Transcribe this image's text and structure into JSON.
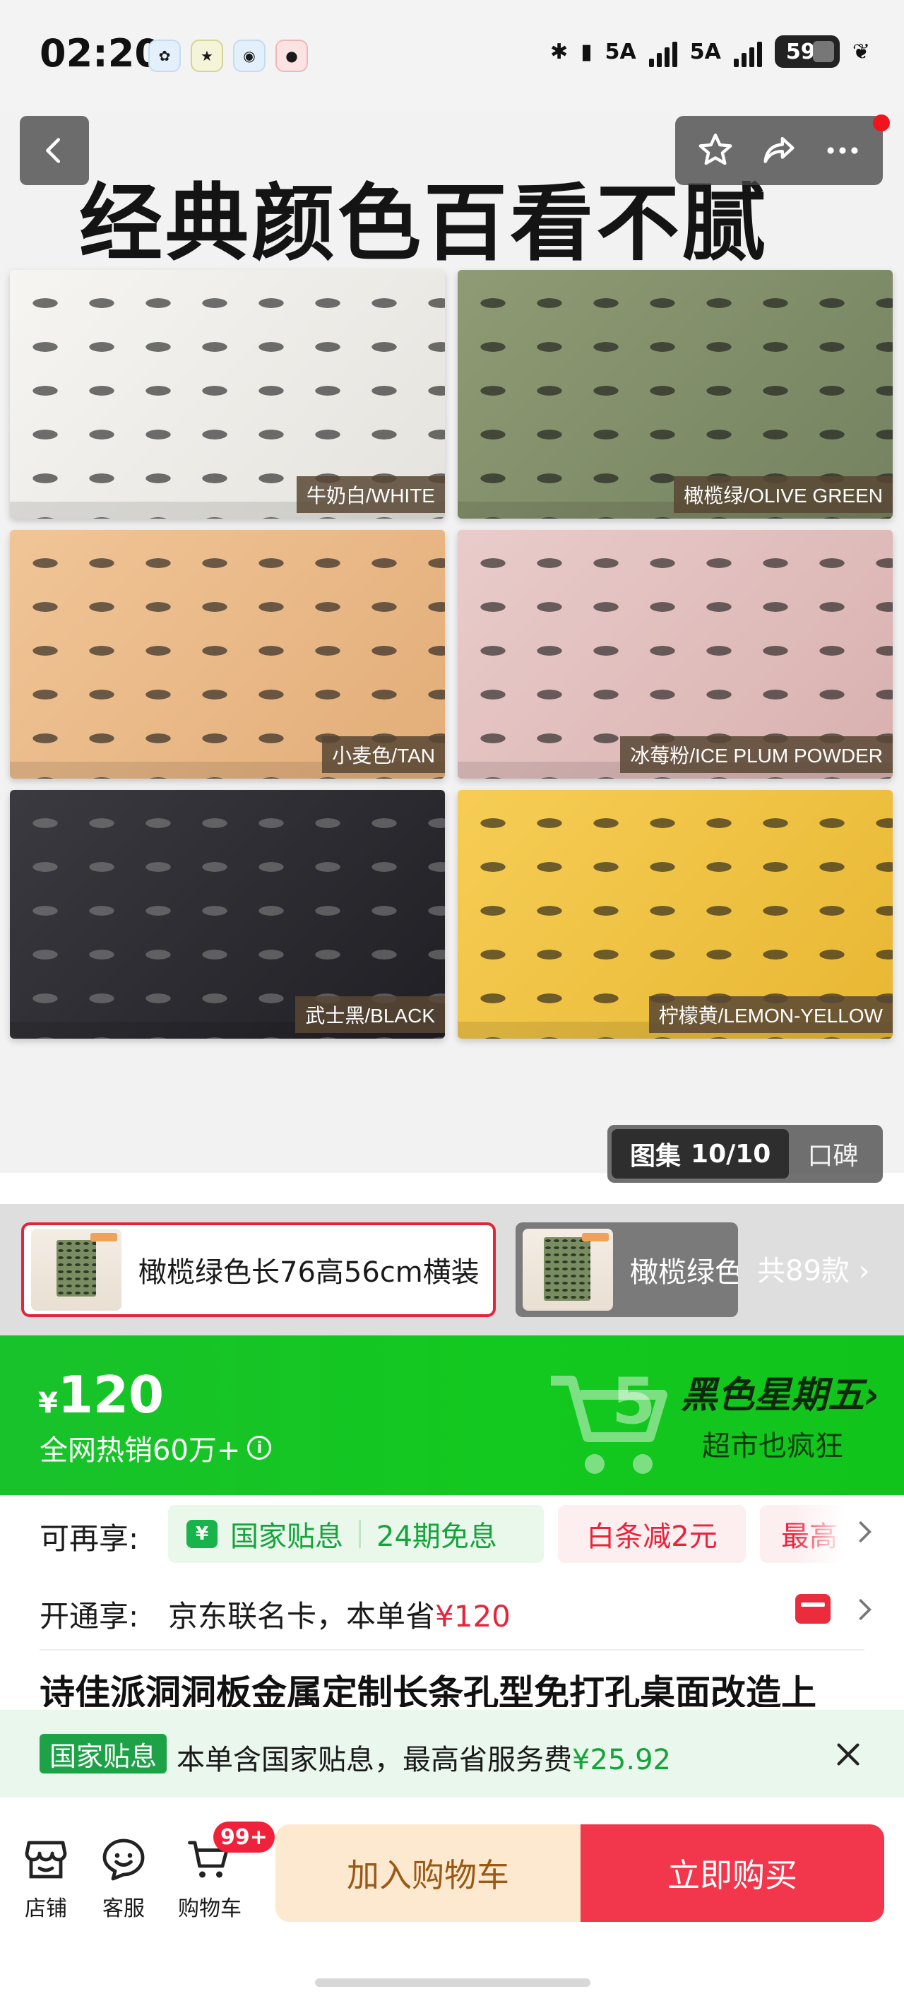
{
  "status_bar": {
    "time": "02:20",
    "network1": "5A",
    "network2": "5A",
    "battery": "59",
    "icons": [
      "bluetooth-icon",
      "vibrate-icon",
      "signal-icon",
      "signal-icon",
      "battery-icon",
      "leaf-icon"
    ]
  },
  "hero": {
    "title": "经典颜色百看不腻",
    "swatches": [
      {
        "label": "牛奶白/WHITE",
        "color": "#f2f1ed"
      },
      {
        "label": "橄榄绿/OLIVE GREEN",
        "color": "#849169"
      },
      {
        "label": "小麦色/TAN",
        "color": "#eab985"
      },
      {
        "label": "冰莓粉/ICE PLUM POWDER",
        "color": "#e1bebc"
      },
      {
        "label": "武士黑/BLACK",
        "color": "#2b2b30"
      },
      {
        "label": "柠檬黄/LEMON-YELLOW",
        "color": "#f0c243"
      }
    ],
    "album_label": "图集",
    "album_counter": "10/10",
    "reviews_tab": "口碑"
  },
  "variants": {
    "selected_label": "橄榄绿色长76高56cm横装",
    "other_label": "橄榄绿色",
    "total": "共89款"
  },
  "price_banner": {
    "currency": "¥",
    "price": "120",
    "sales": "全网热销60万+",
    "promo_title": "黑色星期五",
    "promo_sub": "超市也疯狂",
    "bg_color": "#14c422"
  },
  "benefits": {
    "row1_label": "可再享:",
    "subsidy": "国家贴息",
    "installment": "24期免息",
    "baitiao": "白条减2元",
    "more": "最高",
    "row2_label": "开通享:",
    "row2_text": "京东联名卡，本单省",
    "row2_amount": "¥120"
  },
  "product_title": "诗佳派洞洞板金属定制长条孔型免打孔桌面改造上",
  "notice": {
    "badge": "国家贴息",
    "text": "本单含国家贴息，最高省服务费",
    "amount": "¥25.92"
  },
  "bottom_bar": {
    "shop": "店铺",
    "service": "客服",
    "cart": "购物车",
    "cart_badge": "99+",
    "add_to_cart": "加入购物车",
    "buy_now": "立即购买"
  }
}
